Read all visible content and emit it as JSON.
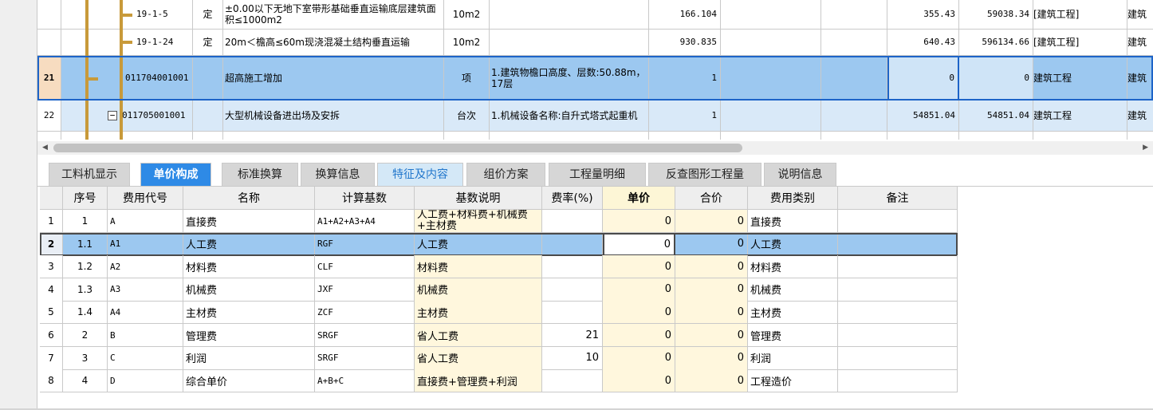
{
  "upper_rows": [
    {
      "rownum": "",
      "code": "19-1-5",
      "type": "定",
      "name": "±0.00以下无地下室带形基础垂直运输底层建筑面积≤1000m2",
      "unit": "10m2",
      "feature": "",
      "qty": "166.104",
      "price": "355.43",
      "total": "59038.34",
      "cat": "[建筑工程]",
      "cat2": "建筑"
    },
    {
      "rownum": "",
      "code": "19-1-24",
      "type": "定",
      "name": "20m＜檐高≤60m现浇混凝土结构垂直运输",
      "unit": "10m2",
      "feature": "",
      "qty": "930.835",
      "price": "640.43",
      "total": "596134.66",
      "cat": "[建筑工程]",
      "cat2": "建筑"
    },
    {
      "rownum": "21",
      "code": "011704001001",
      "type": "",
      "name": "超高施工增加",
      "unit": "项",
      "feature": "1.建筑物檐口高度、层数:50.88m，17层",
      "qty": "1",
      "price": "0",
      "total": "0",
      "cat": "建筑工程",
      "cat2": "建筑"
    },
    {
      "rownum": "22",
      "code": "011705001001",
      "type": "",
      "name": "大型机械设备进出场及安拆",
      "unit": "台次",
      "feature": "1.机械设备名称:自升式塔式起重机",
      "qty": "1",
      "price": "54851.04",
      "total": "54851.04",
      "cat": "建筑工程",
      "cat2": "建筑"
    }
  ],
  "tree_toggle": "−",
  "scroll": {
    "left": "◀",
    "right": "▶"
  },
  "tabs": [
    {
      "label": "工料机显示"
    },
    {
      "label": "单价构成"
    },
    {
      "label": "标准换算"
    },
    {
      "label": "换算信息"
    },
    {
      "label": "特征及内容"
    },
    {
      "label": "组价方案"
    },
    {
      "label": "工程量明细"
    },
    {
      "label": "反查图形工程量"
    },
    {
      "label": "说明信息"
    }
  ],
  "lower_headers": [
    "",
    "序号",
    "费用代号",
    "名称",
    "计算基数",
    "基数说明",
    "费率(%)",
    "单价",
    "合价",
    "费用类别",
    "备注"
  ],
  "lower_rows": [
    {
      "n": "1",
      "seq": "1",
      "code": "A",
      "name": "直接费",
      "base": "A1+A2+A3+A4",
      "desc": "人工费+材料费+机械费+主材费",
      "rate": "",
      "unit_price": "0",
      "total": "0",
      "category": "直接费",
      "note": ""
    },
    {
      "n": "2",
      "seq": "1.1",
      "code": "A1",
      "name": "人工费",
      "base": "RGF",
      "desc": "人工费",
      "rate": "",
      "unit_price": "0",
      "total": "0",
      "category": "人工费",
      "note": ""
    },
    {
      "n": "3",
      "seq": "1.2",
      "code": "A2",
      "name": "材料费",
      "base": "CLF",
      "desc": "材料费",
      "rate": "",
      "unit_price": "0",
      "total": "0",
      "category": "材料费",
      "note": ""
    },
    {
      "n": "4",
      "seq": "1.3",
      "code": "A3",
      "name": "机械费",
      "base": "JXF",
      "desc": "机械费",
      "rate": "",
      "unit_price": "0",
      "total": "0",
      "category": "机械费",
      "note": ""
    },
    {
      "n": "5",
      "seq": "1.4",
      "code": "A4",
      "name": "主材费",
      "base": "ZCF",
      "desc": "主材费",
      "rate": "",
      "unit_price": "0",
      "total": "0",
      "category": "主材费",
      "note": ""
    },
    {
      "n": "6",
      "seq": "2",
      "code": "B",
      "name": "管理费",
      "base": "SRGF",
      "desc": "省人工费",
      "rate": "21",
      "unit_price": "0",
      "total": "0",
      "category": "管理费",
      "note": ""
    },
    {
      "n": "7",
      "seq": "3",
      "code": "C",
      "name": "利润",
      "base": "SRGF",
      "desc": "省人工费",
      "rate": "10",
      "unit_price": "0",
      "total": "0",
      "category": "利润",
      "note": ""
    },
    {
      "n": "8",
      "seq": "4",
      "code": "D",
      "name": "综合单价",
      "base": "A+B+C",
      "desc": "直接费+管理费+利润",
      "rate": "",
      "unit_price": "0",
      "total": "0",
      "category": "工程造价",
      "note": ""
    }
  ],
  "colors": {
    "accent": "#2e8ae6",
    "selected_row": "#9cc8f0",
    "hover_row": "#d9e9f8",
    "yellow_cell": "#fff7dd",
    "border": "#c9c9c9"
  }
}
